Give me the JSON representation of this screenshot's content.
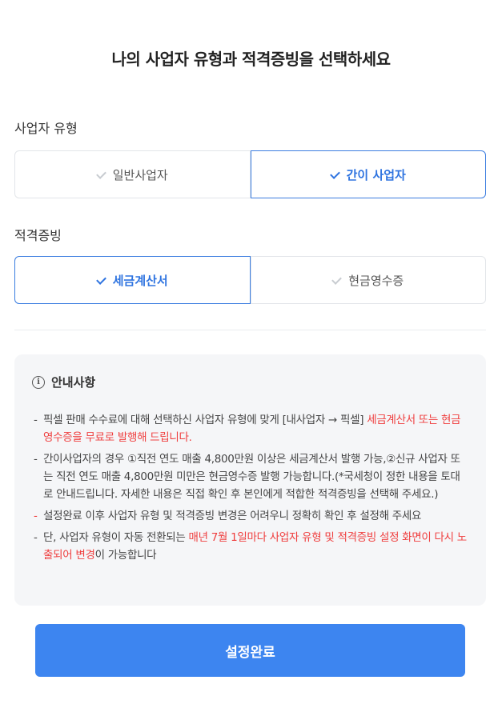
{
  "page": {
    "title": "나의 사업자 유형과 적격증빙을 선택하세요"
  },
  "business_type": {
    "label": "사업자 유형",
    "options": [
      {
        "label": "일반사업자",
        "selected": false
      },
      {
        "label": "간이 사업자",
        "selected": true
      }
    ]
  },
  "proof": {
    "label": "적격증빙",
    "options": [
      {
        "label": "세금계산서",
        "selected": true
      },
      {
        "label": "현금영수증",
        "selected": false
      }
    ]
  },
  "notice": {
    "heading": "안내사항",
    "icon": "info-icon",
    "items": [
      {
        "text_before": "픽셀 판매 수수료에 대해 선택하신 사업자 유형에 맞게 [내사업자 → 픽셀] ",
        "text_highlight": "세금계산서 또는 현금영수증을 무료로 발행해 드립니다."
      },
      {
        "text": "간이사업자의 경우 ①직전 연도 매출 4,800만원 이상은 세금계산서 발행 가능,②신규 사업자 또는 직전 연도 매출 4,800만원 미만은 현금영수증 발행 가능합니다.(*국세청이 정한 내용을 토대로 안내드립니다. 자세한 내용은 직접 확인 후 본인에게 적합한 적격증빙을 선택해 주세요.)"
      },
      {
        "text": "설정완료 이후 사업자 유형 및 적격증빙 변경은 어려우니 정확히 확인 후 설정해 주세요"
      },
      {
        "text_before": "단, 사업자 유형이 자동 전환되는 ",
        "text_highlight": "매년 7월 1일마다 사업자 유형 및 적격증빙 설정 화면이 다시 노출되어 변경",
        "text_after": "이 가능합니다"
      }
    ]
  },
  "submit": {
    "label": "설정완료"
  },
  "colors": {
    "accent": "#3d85f0",
    "selected_border": "#3b7de0",
    "warning": "#ef3e3e",
    "notice_bg": "#f5f6f8"
  }
}
